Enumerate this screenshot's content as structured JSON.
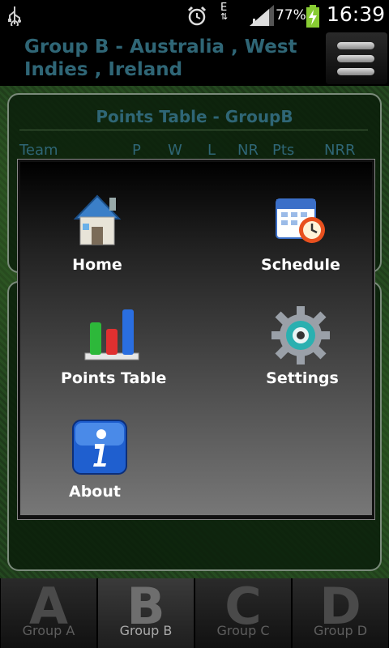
{
  "status_bar": {
    "network": "E",
    "battery_percent": "77%",
    "time": "16:39"
  },
  "header": {
    "title": "Group B - Australia , West Indies , Ireland"
  },
  "points_table": {
    "title": "Points Table - GroupB",
    "columns": [
      "Team",
      "P",
      "W",
      "L",
      "NR",
      "Pts",
      "NRR"
    ]
  },
  "menu": {
    "items": [
      {
        "label": "Home",
        "icon": "house-icon"
      },
      {
        "label": "Schedule",
        "icon": "calendar-clock-icon"
      },
      {
        "label": "Points Table",
        "icon": "bar-chart-icon"
      },
      {
        "label": "Settings",
        "icon": "gear-icon"
      },
      {
        "label": "About",
        "icon": "info-icon"
      }
    ]
  },
  "tabs": [
    {
      "letter": "A",
      "label": "Group A",
      "active": false
    },
    {
      "letter": "B",
      "label": "Group B",
      "active": true
    },
    {
      "letter": "C",
      "label": "Group C",
      "active": false
    },
    {
      "letter": "D",
      "label": "Group D",
      "active": false
    }
  ],
  "colors": {
    "header_text": "#2f6676",
    "menu_label": "#ffffff",
    "tab_inactive": "#4a4a4a"
  }
}
